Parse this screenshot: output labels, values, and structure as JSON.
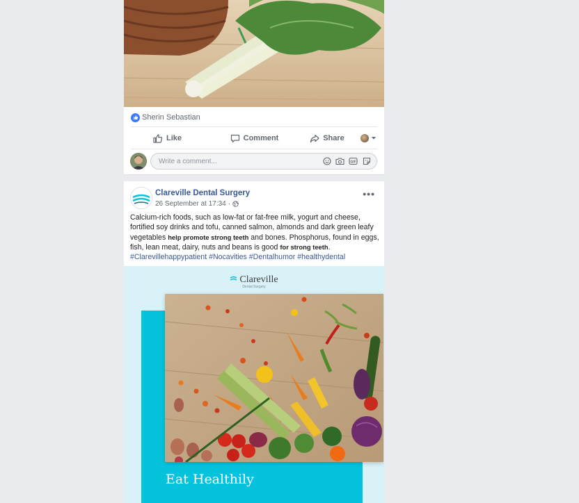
{
  "post1": {
    "reactor_name": "Sherin Sebastian",
    "actions": {
      "like": "Like",
      "comment": "Comment",
      "share": "Share"
    },
    "comment_placeholder": "Write a comment..."
  },
  "post2": {
    "page_name": "Clareville Dental Surgery",
    "timestamp": "26 September at 17:34",
    "more": "•••",
    "text": {
      "p1": "Calcium-rich foods, such as low-fat or fat-free milk, yogurt and cheese, fortified soy drinks and tofu, canned salmon, almonds and dark green leafy vegetables ",
      "b1": "help promote strong teeth",
      "p2": " and bones. Phosphorus, found in eggs, fish, lean meat, dairy, nuts and beans is good ",
      "b2": "for strong teeth",
      "p3": "."
    },
    "hashtags": "#Clarevillehappypatient #Nocavities #Dentalhumor #healthydental",
    "graphic": {
      "brand": "Clareville",
      "brand_sub": "Dental Surgery",
      "headline": "Eat Healthily"
    }
  },
  "colors": {
    "background": "#e9ebee",
    "link": "#385898",
    "teal": "#05c3dd",
    "light_teal": "#d8f2f8",
    "like_blue": "#3b7bff"
  }
}
